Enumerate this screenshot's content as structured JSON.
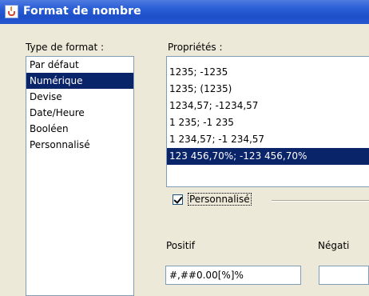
{
  "window": {
    "title": "Format de nombre",
    "app_icon": "java-icon"
  },
  "format_type": {
    "label": "Type de format :",
    "items": [
      "Par défaut",
      "Numérique",
      "Devise",
      "Date/Heure",
      "Booléen",
      "Personnalisé"
    ],
    "selected": "Numérique"
  },
  "properties": {
    "label": "Propriétés :",
    "items": [
      "1235; -1235",
      "1235; (1235)",
      "1234,57; -1234,57",
      "1 235; -1 235",
      "1 234,57; -1 234,57",
      "123 456,70%; -123 456,70%"
    ],
    "selected": "123 456,70%; -123 456,70%"
  },
  "custom": {
    "label": "Personnalisé",
    "checked": true
  },
  "positive": {
    "label": "Positif",
    "value": "#,##0.00[%]%"
  },
  "negative": {
    "label": "Négati",
    "value": ""
  },
  "colors": {
    "title_bar": "#2457cf",
    "selection": "#0a246a",
    "dialog_bg": "#ece9d8"
  }
}
